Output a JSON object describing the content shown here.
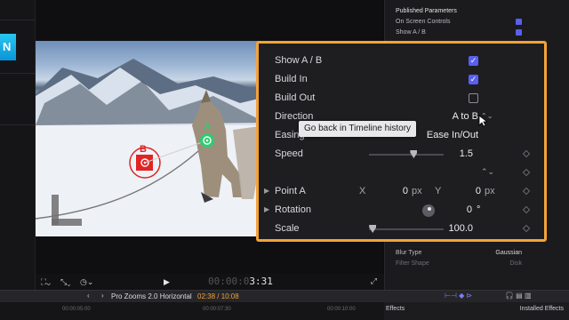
{
  "inspector": {
    "section_title": "Published Parameters",
    "rows": [
      {
        "label": "On Screen Controls",
        "kind": "check"
      },
      {
        "label": "Show A / B",
        "kind": "check"
      }
    ],
    "lower_rows": [
      {
        "label": "Blur Type",
        "value": "Gaussian"
      },
      {
        "label": "Filter Shape",
        "value": "Disk"
      }
    ]
  },
  "panel": {
    "rows": [
      {
        "label": "Show A / B",
        "control": "checkbox",
        "checked": true
      },
      {
        "label": "Build In",
        "control": "checkbox",
        "checked": true
      },
      {
        "label": "Build Out",
        "control": "checkbox",
        "checked": false
      },
      {
        "label": "Direction",
        "control": "popup",
        "value": "A to B"
      },
      {
        "label": "Easing",
        "control": "popup",
        "value": "Ease In/Out"
      },
      {
        "label": "Speed",
        "control": "slider",
        "value": "1.5",
        "level": 0.6
      },
      {
        "label": "Point A",
        "control": "point",
        "x_label": "X",
        "x_value": "0",
        "x_unit": "px",
        "y_label": "Y",
        "y_value": "0",
        "y_unit": "px"
      },
      {
        "label": "Rotation",
        "control": "dial",
        "value": "0",
        "unit": "°"
      },
      {
        "label": "Scale",
        "control": "slider",
        "value": "100.0",
        "level": 0.05
      }
    ]
  },
  "tooltip": "Go back in Timeline history",
  "onscreen": {
    "point_a_label": "A",
    "point_b_label": "B"
  },
  "viewer_toolbar": {
    "timecode_dim": "00:00:0",
    "timecode_bright": "3:31"
  },
  "timeline": {
    "project_name": "Pro Zooms 2.0 Horizontal",
    "position": "02:38 / 10:08",
    "ruler_ticks": [
      "00:00:05:00",
      "00:00:07:30",
      "00:00:10:00"
    ]
  },
  "effects": {
    "tab_label": "Effects",
    "filter_label": "Installed Effects"
  },
  "colors": {
    "accent_orange": "#f2a33a",
    "checkbox_blue": "#5a5ff0",
    "point_a_green": "#2ecc71",
    "point_b_red": "#e02424"
  }
}
